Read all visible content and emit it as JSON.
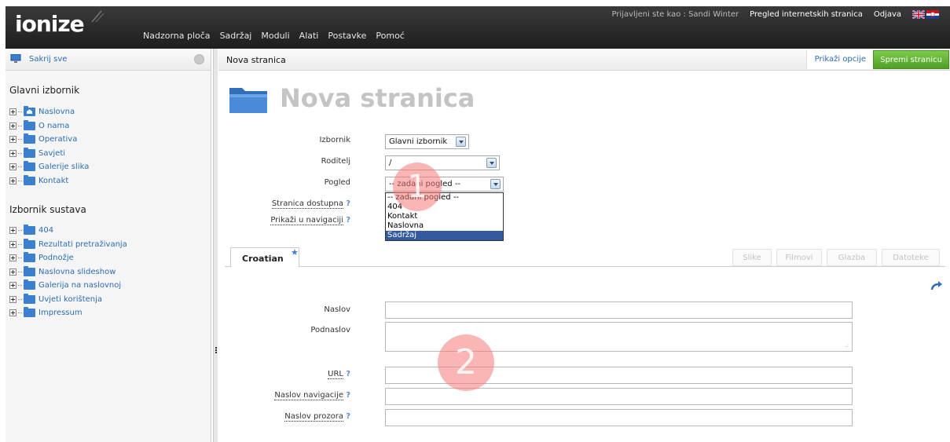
{
  "header": {
    "logo": "ionize",
    "nav": [
      "Nadzorna ploča",
      "Sadržaj",
      "Moduli",
      "Alati",
      "Postavke",
      "Pomoć"
    ],
    "user_info": "Prijavljeni ste kao : Sandi Winter",
    "view_site": "Pregled internetskih stranica",
    "logout": "Odjava",
    "flag_icons": [
      "uk-flag-icon",
      "hr-flag-icon"
    ]
  },
  "sidebar": {
    "hide_all": "Sakrij sve",
    "menu1_title": "Glavni izbornik",
    "menu1_items": [
      "Naslovna",
      "O nama",
      "Operativa",
      "Savjeti",
      "Galerije slika",
      "Kontakt"
    ],
    "menu2_title": "Izbornik sustava",
    "menu2_items": [
      "404",
      "Rezultati pretraživanja",
      "Podnožje",
      "Naslovna slideshow",
      "Galerija na naslovnoj",
      "Uvjeti korištenja",
      "Impressum"
    ]
  },
  "main": {
    "panel_title": "Nova stranica",
    "show_options": "Prikaži opcije",
    "save_page": "Spremi stranicu",
    "heading": "Nova stranica",
    "labels": {
      "menu": "Izbornik",
      "parent": "Roditelj",
      "view": "Pogled",
      "available": "Stranica dostupna",
      "show_in_nav": "Prikaži u navigaciji",
      "qmark": "?"
    },
    "menu_value": "Glavni izbornik",
    "parent_value": "/",
    "view_value": "-- zadani pogled --",
    "view_options": [
      "-- zadani pogled --",
      "404",
      "Kontakt",
      "Naslovna",
      "Sadržaj"
    ],
    "view_selected_index": 4,
    "tab_active": "Croatian",
    "tabs_right": [
      "Slike",
      "Filmovi",
      "Glazba",
      "Datoteke"
    ],
    "fields": {
      "title": "Naslov",
      "subtitle": "Podnaslov",
      "url": "URL",
      "nav_title": "Naslov navigacije",
      "window_title": "Naslov prozora"
    }
  },
  "markers": [
    "1",
    "2"
  ],
  "colors": {
    "accent_blue": "#2a6db5",
    "save_green": "#5cb032",
    "header_dark": "#2b2b2b",
    "dropdown_selected": "#33599e",
    "marker": "#f57878"
  }
}
